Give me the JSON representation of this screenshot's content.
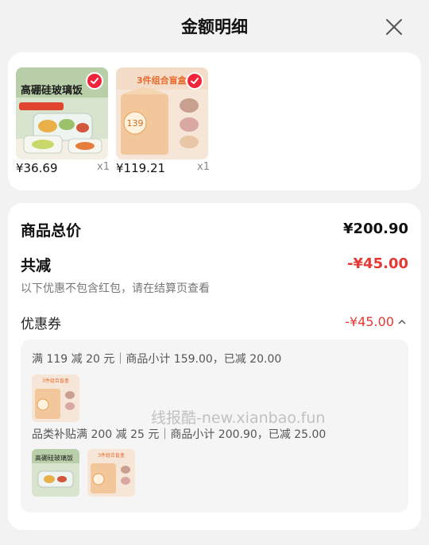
{
  "header": {
    "title": "金额明细"
  },
  "products": [
    {
      "price": "¥36.69",
      "qty": "x1",
      "image_text": "高硼硅玻璃饭"
    },
    {
      "price": "¥119.21",
      "qty": "x1",
      "image_text": "3件组合盲盒"
    }
  ],
  "summary": {
    "total_label": "商品总价",
    "total_value": "¥200.90",
    "discount_label": "共减",
    "discount_value": "-¥45.00",
    "note": "以下优惠不包含红包，请在结算页查看",
    "coupon_label": "优惠券",
    "coupon_value": "-¥45.00"
  },
  "coupon_details": [
    {
      "rule": "满 119 减 20 元｜商品小计 159.00，已减 20.00"
    },
    {
      "rule": "品类补贴满 200 减 25 元｜商品小计 200.90，已减 25.00"
    }
  ],
  "watermark": "线报酷-new.xianbao.fun",
  "colors": {
    "accent_red": "#e53935",
    "check_red": "#f0243a",
    "background": "#f2f2f2"
  }
}
